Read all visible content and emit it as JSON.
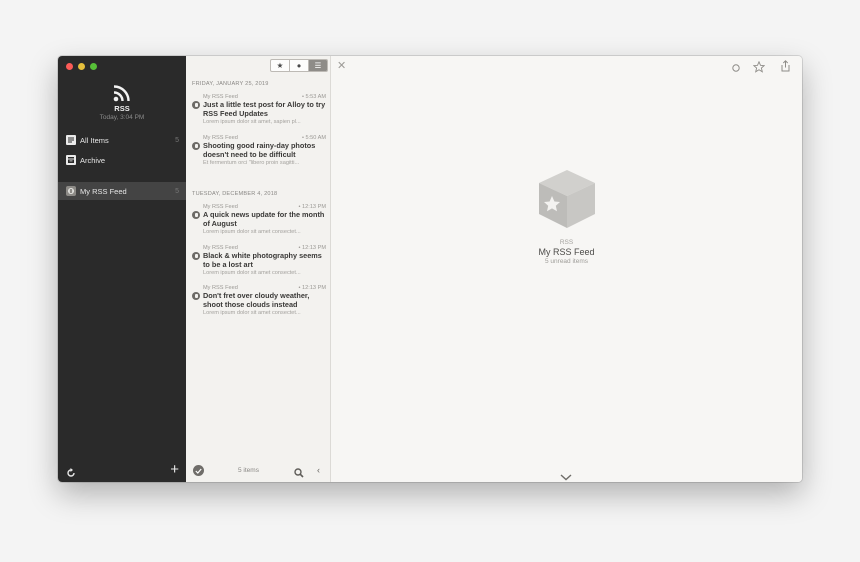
{
  "sidebar": {
    "app_name": "RSS",
    "timestamp": "Today, 3:04 PM",
    "items": [
      {
        "label": "All Items",
        "count": "5",
        "icon": "all-items-icon"
      },
      {
        "label": "Archive",
        "count": "",
        "icon": "archive-icon"
      },
      {
        "label": "My RSS Feed",
        "count": "5",
        "icon": "feed-icon"
      }
    ]
  },
  "list": {
    "filters": [
      {
        "name": "starred",
        "glyph": "★"
      },
      {
        "name": "unread",
        "glyph": "●"
      },
      {
        "name": "all",
        "glyph": "☰"
      }
    ],
    "groups": [
      {
        "date": "FRIDAY, JANUARY 25, 2019",
        "articles": [
          {
            "feed": "My RSS Feed",
            "time": "• 5:53 AM",
            "title": "Just a little test post for Alloy to try RSS Feed Updates",
            "excerpt": "Lorem ipsum dolor sit amet, sapien pl..."
          },
          {
            "feed": "My RSS Feed",
            "time": "• 5:50 AM",
            "title": "Shooting good rainy-day photos doesn't need to be difficult",
            "excerpt": "Et fermentum orci \"libero proin sagitti..."
          }
        ]
      },
      {
        "date": "TUESDAY, DECEMBER 4, 2018",
        "articles": [
          {
            "feed": "My RSS Feed",
            "time": "• 12:13 PM",
            "title": "A quick news update for the month of August",
            "excerpt": "Lorem ipsum dolor sit amet consectet..."
          },
          {
            "feed": "My RSS Feed",
            "time": "• 12:13 PM",
            "title": "Black & white photography seems to be a lost art",
            "excerpt": "Lorem ipsum dolor sit amet consectet..."
          },
          {
            "feed": "My RSS Feed",
            "time": "• 12:13 PM",
            "title": "Don't fret over cloudy weather, shoot those clouds instead",
            "excerpt": "Lorem ipsum dolor sit amet consectet..."
          }
        ]
      }
    ],
    "footer": {
      "item_count": "5 items"
    }
  },
  "detail": {
    "label": "RSS",
    "feed_name": "My RSS Feed",
    "unread": "5 unread items"
  }
}
